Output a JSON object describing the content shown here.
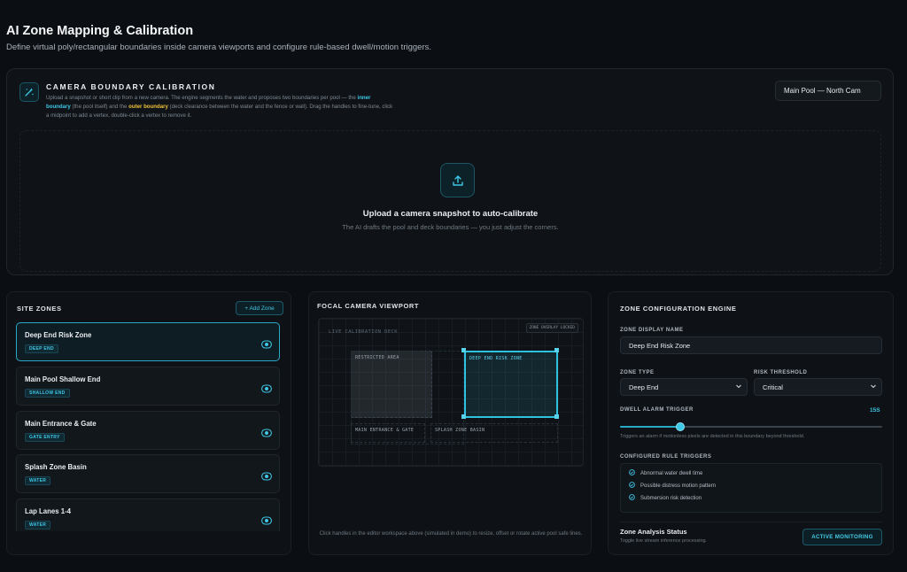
{
  "header": {
    "title": "AI Zone Mapping & Calibration",
    "subtitle": "Define virtual poly/rectangular boundaries inside camera viewports and configure rule-based dwell/motion triggers."
  },
  "calibration": {
    "icon": "wand-icon",
    "heading": "CAMERA BOUNDARY CALIBRATION",
    "desc_part1": "Upload a snapshot or short clip from a new camera. The engine segments the water and proposes two boundaries per pool — the ",
    "inner_label": "inner boundary",
    "desc_part2": " (the pool itself) and the ",
    "outer_label": "outer boundary",
    "desc_part3": " (deck clearance between the water and the fence or wall). Drag the handles to fine-tune, click a midpoint to add a vertex, double-click a vertex to remove it.",
    "camera_value": "Main Pool — North Cam",
    "upload_icon": "upload-icon",
    "upload_title": "Upload a camera snapshot to auto-calibrate",
    "upload_subtitle": "The AI drafts the pool and deck boundaries — you just adjust the corners.",
    "colors": {
      "accent": "#3fc7e6",
      "outer": "#f0c23b"
    }
  },
  "site_zones": {
    "title": "SITE ZONES",
    "add_label": "+ Add Zone",
    "zones": [
      {
        "name": "Deep End Risk Zone",
        "tag": "DEEP END",
        "active": true
      },
      {
        "name": "Main Pool Shallow End",
        "tag": "SHALLOW END",
        "active": false
      },
      {
        "name": "Main Entrance & Gate",
        "tag": "GATE ENTRY",
        "active": false
      },
      {
        "name": "Splash Zone Basin",
        "tag": "WATER",
        "active": false
      },
      {
        "name": "Lap Lanes 1-4",
        "tag": "WATER",
        "active": false
      }
    ]
  },
  "viewport": {
    "title": "FOCAL CAMERA VIEWPORT",
    "overlay_badge": "ZONE OVERLAY LOCKED",
    "live_label": "LIVE CALIBRATION DECK",
    "zone_labels": {
      "restricted": "RESTRICTED AREA",
      "deep_end": "DEEP END RISK ZONE",
      "entrance": "MAIN ENTRANCE & GATE",
      "splash": "SPLASH ZONE BASIN"
    },
    "hint": "Click handles in the editor workspace above (simulated in demo) to resize, offset or rotate active pool safe lines."
  },
  "config": {
    "title": "ZONE CONFIGURATION ENGINE",
    "display_name_label": "ZONE DISPLAY NAME",
    "display_name_value": "Deep End Risk Zone",
    "zone_type_label": "ZONE TYPE",
    "zone_type_value": "Deep End",
    "risk_label": "RISK THRESHOLD",
    "risk_value": "Critical",
    "dwell_label": "DWELL ALARM TRIGGER",
    "dwell_value": "15S",
    "dwell_fraction": 0.23,
    "dwell_hint": "Triggers an alarm if motionless pixels are detected in this boundary beyond threshold.",
    "rules_label": "CONFIGURED RULE TRIGGERS",
    "rules": [
      "Abnormal water dwell time",
      "Possible distress motion pattern",
      "Submersion risk detection"
    ],
    "status_title": "Zone Analysis Status",
    "status_sub": "Toggle live stream inference processing.",
    "status_button": "ACTIVE MONITORING"
  }
}
